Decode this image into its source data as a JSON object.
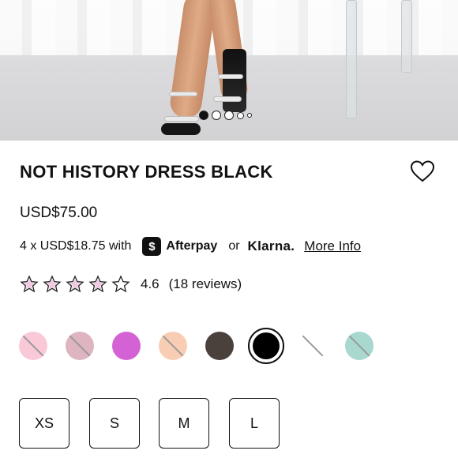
{
  "gallery": {
    "image_alt": "Model wearing black dress with clear strappy heels",
    "dots": [
      {
        "state": "active"
      },
      {
        "state": "inactive"
      },
      {
        "state": "inactive"
      },
      {
        "state": "small"
      },
      {
        "state": "smaller"
      }
    ]
  },
  "product": {
    "title": "NOT HISTORY DRESS BLACK",
    "price": "USD$75.00"
  },
  "installments": {
    "prefix": "4 x USD$18.75 with",
    "afterpay_symbol": "$",
    "afterpay_label": "Afterpay",
    "or_label": "or",
    "klarna_label": "Klarna.",
    "more_info_label": "More Info"
  },
  "rating": {
    "value": "4.6",
    "reviews_label": "(18 reviews)",
    "star_color": "#e9b8d7",
    "stars": 5
  },
  "swatches": [
    {
      "color": "#f9c9d8",
      "out_of_stock": true
    },
    {
      "color": "#ddb4c0",
      "out_of_stock": true
    },
    {
      "color": "#d462d4",
      "out_of_stock": false
    },
    {
      "color": "#f8cdb4",
      "out_of_stock": true
    },
    {
      "color": "#4a413d",
      "out_of_stock": false
    },
    {
      "color": "#000000",
      "out_of_stock": false,
      "selected": true
    },
    {
      "color": "#ffffff",
      "out_of_stock": true
    },
    {
      "color": "#a8d8cf",
      "out_of_stock": true
    }
  ],
  "sizes": [
    "XS",
    "S",
    "M",
    "L"
  ]
}
